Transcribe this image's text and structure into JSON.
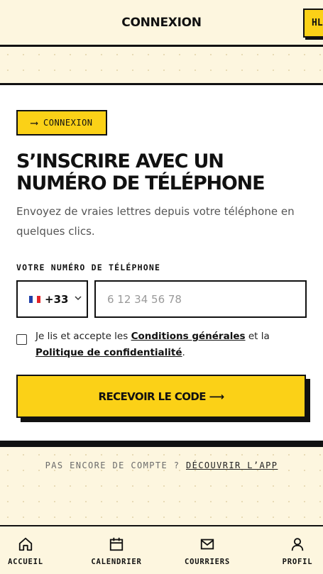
{
  "header": {
    "title": "CONNEXION",
    "lang_button": "HL"
  },
  "card": {
    "tag": {
      "arrow": "⟶",
      "label": "CONNEXION"
    },
    "heading": "S’inscrire avec un numéro de téléphone",
    "subtitle": "Envoyez de vraies lettres depuis votre téléphone en quelques clics.",
    "field_label": "VOTRE NUMÉRO DE TÉLÉPHONE",
    "country": {
      "flag_icon": "france-flag-icon",
      "code": "+33"
    },
    "phone": {
      "value": "",
      "placeholder": "6 12 34 56 78"
    },
    "terms": {
      "checked": false,
      "prefix": "Je lis et accepte les ",
      "conditions_link": "Conditions générales",
      "middle": " et la ",
      "privacy_link": "Politique de confidentialité",
      "suffix": "."
    },
    "submit_label": "Recevoir le code ⟶"
  },
  "signup": {
    "prompt": "PAS ENCORE DE COMPTE ? ",
    "link": "DÉCOUVRIR L’APP"
  },
  "nav": {
    "items": [
      {
        "label": "ACCUEIL",
        "icon": "home-icon"
      },
      {
        "label": "CALENDRIER",
        "icon": "calendar-icon"
      },
      {
        "label": "COURRIERS",
        "icon": "mail-icon"
      },
      {
        "label": "PROFIL",
        "icon": "user-icon"
      }
    ]
  },
  "colors": {
    "accent": "#fbd117",
    "background": "#fdf6df",
    "ink": "#111111",
    "card": "#ffffff"
  }
}
